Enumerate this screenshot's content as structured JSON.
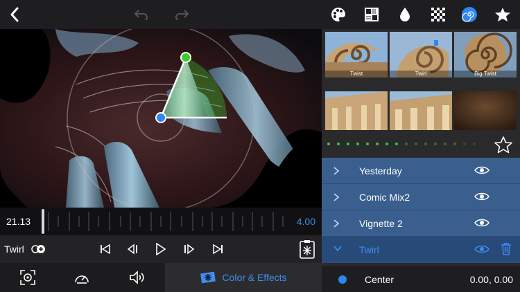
{
  "colors": {
    "accent": "#3d8ef0",
    "layer_bg": "#3a5f8f",
    "layer_selected_bg": "#284a78",
    "handle_green": "#3ccc2e",
    "handle_blue": "#2f86f2"
  },
  "topbar": {
    "icons": [
      "back-chevron-icon",
      "undo-icon",
      "redo-icon",
      "palette-icon",
      "texture-icon",
      "drop-icon",
      "pixelate-icon",
      "swirl-icon",
      "star-icon"
    ]
  },
  "timeline": {
    "current_time": "21.13",
    "duration": "4.00"
  },
  "transport": {
    "effect_label": "Twirl"
  },
  "bottombar": {
    "active_tab_label": "Color & Effects",
    "icons": [
      "frame-icon",
      "speedometer-icon",
      "speaker-icon",
      "effects-icon"
    ]
  },
  "presets": [
    {
      "label": "Twist"
    },
    {
      "label": "Twirl"
    },
    {
      "label": "Big Twist"
    },
    {
      "label": ""
    },
    {
      "label": ""
    },
    {
      "label": ""
    }
  ],
  "dots": {
    "active_count": 8,
    "total": 16
  },
  "layers": [
    {
      "name": "Yesterday",
      "selected": false
    },
    {
      "name": "Comic Mix2",
      "selected": false
    },
    {
      "name": "Vignette 2",
      "selected": false
    },
    {
      "name": "Twirl",
      "selected": true
    }
  ],
  "param": {
    "name": "Center",
    "value": "0.00, 0.00"
  }
}
